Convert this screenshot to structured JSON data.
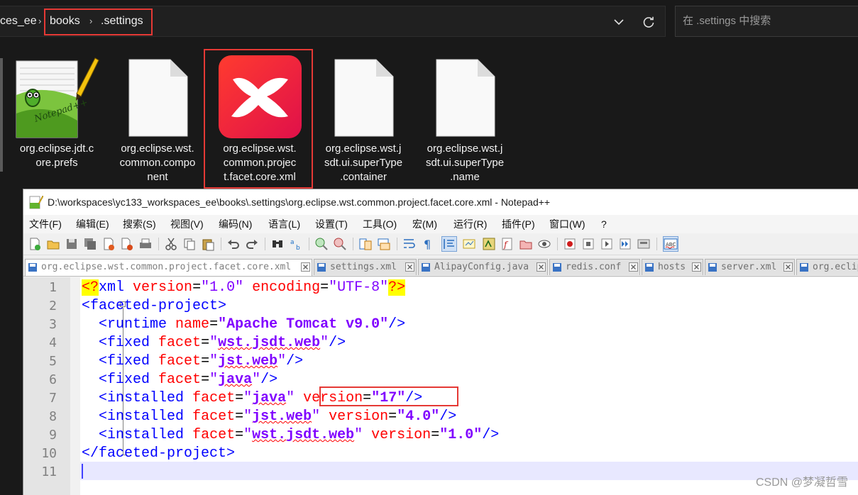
{
  "explorer": {
    "breadcrumbs": [
      "ces_ee",
      "books",
      ".settings"
    ],
    "search_placeholder": "在 .settings 中搜索",
    "files": [
      {
        "name": "org.eclipse.jdt.core.prefs",
        "icon": "notepadpp-file-icon"
      },
      {
        "name": "org.eclipse.wst.common.component",
        "icon": "blank-file-icon"
      },
      {
        "name": "org.eclipse.wst.common.project.facet.core.xml",
        "icon": "xmind-file-icon"
      },
      {
        "name": "org.eclipse.wst.jsdt.ui.superType.container",
        "icon": "blank-file-icon"
      },
      {
        "name": "org.eclipse.wst.jsdt.ui.superType.name",
        "icon": "blank-file-icon"
      }
    ],
    "filename_lines": [
      [
        "org.eclipse.jdt.c",
        "ore.prefs"
      ],
      [
        "org.eclipse.wst.",
        "common.compo",
        "nent"
      ],
      [
        "org.eclipse.wst.",
        "common.projec",
        "t.facet.core.xml"
      ],
      [
        "org.eclipse.wst.j",
        "sdt.ui.superType",
        ".container"
      ],
      [
        "org.eclipse.wst.j",
        "sdt.ui.superType",
        ".name"
      ]
    ]
  },
  "notepad": {
    "title": "D:\\workspaces\\yc133_workspaces_ee\\books\\.settings\\org.eclipse.wst.common.project.facet.core.xml - Notepad++",
    "menu": [
      "文件(F)",
      "编辑(E)",
      "搜索(S)",
      "视图(V)",
      "编码(N)",
      "语言(L)",
      "设置(T)",
      "工具(O)",
      "宏(M)",
      "运行(R)",
      "插件(P)",
      "窗口(W)",
      "?"
    ],
    "tabs": [
      "org.eclipse.wst.common.project.facet.core.xml",
      "settings.xml",
      "AlipayConfig.java",
      "redis.conf",
      "hosts",
      "server.xml",
      "org.eclipse"
    ],
    "line_numbers": [
      "1",
      "2",
      "3",
      "4",
      "5",
      "6",
      "7",
      "8",
      "9",
      "10",
      "11"
    ],
    "code": {
      "l1": {
        "decl_open": "<?",
        "tag": "xml",
        "a1": "version",
        "v1": "\"1.0\"",
        "a2": "encoding",
        "v2": "\"UTF-8\"",
        "decl_close": "?>"
      },
      "l2": {
        "open": "<faceted-project>"
      },
      "l3": {
        "tag": "<runtime",
        "a1": "name",
        "v1": "\"Apache Tomcat v9.0\"",
        "end": "/>"
      },
      "l4": {
        "tag": "<fixed",
        "a1": "facet",
        "v1": "wst.jsdt.web",
        "end": "/>"
      },
      "l5": {
        "tag": "<fixed",
        "a1": "facet",
        "v1": "jst.web",
        "end": "/>"
      },
      "l6": {
        "tag": "<fixed",
        "a1": "facet",
        "v1": "java",
        "end": "/>"
      },
      "l7": {
        "tag": "<installed",
        "a1": "facet",
        "v1": "java",
        "a2": "version",
        "v2": "\"17\"",
        "end": "/>"
      },
      "l8": {
        "tag": "<installed",
        "a1": "facet",
        "v1": "jst.web",
        "a2": "version",
        "v2": "\"4.0\"",
        "end": "/>"
      },
      "l9": {
        "tag": "<installed",
        "a1": "facet",
        "v1": "wst.jsdt.web",
        "a2": "version",
        "v2": "\"1.0\"",
        "end": "/>"
      },
      "l10": {
        "close": "</faceted-project>"
      }
    }
  },
  "watermark": "CSDN @梦凝哲雪",
  "colors": {
    "highlight": "#e53935",
    "xml_tag": "#0000ff",
    "xml_attr": "#ff0000",
    "xml_string": "#8000ff"
  }
}
